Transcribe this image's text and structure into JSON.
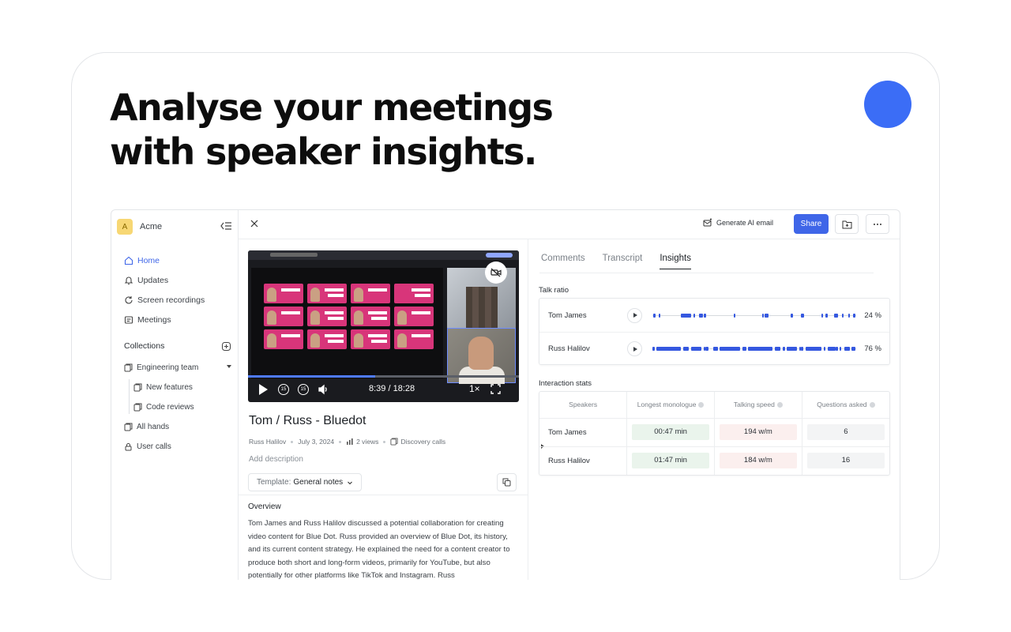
{
  "hero": {
    "line1": "Analyse your meetings",
    "line2": "with speaker insights."
  },
  "colors": {
    "accent": "#3b6df6",
    "primary_button": "#3f66e8",
    "bar": "#3558e0"
  },
  "workspace": {
    "initial": "A",
    "name": "Acme"
  },
  "sidebar": {
    "nav": [
      {
        "label": "Home",
        "icon": "home-icon",
        "active": true
      },
      {
        "label": "Updates",
        "icon": "bell-icon"
      },
      {
        "label": "Screen recordings",
        "icon": "refresh-icon"
      },
      {
        "label": "Meetings",
        "icon": "meetings-icon"
      }
    ],
    "collections_title": "Collections",
    "collections": [
      {
        "label": "Engineering team",
        "icon": "folder-icon",
        "expanded": true
      },
      {
        "label": "New features",
        "icon": "folder-icon",
        "sub": true
      },
      {
        "label": "Code reviews",
        "icon": "folder-icon",
        "sub": true
      },
      {
        "label": "All hands",
        "icon": "folder-icon"
      },
      {
        "label": "User calls",
        "icon": "lock-icon",
        "collapsed": true
      }
    ]
  },
  "topbar": {
    "generate_email": "Generate AI email",
    "share": "Share"
  },
  "video": {
    "current_time": "8:39 / 18:28",
    "speed": "1×",
    "skip_back": "15",
    "skip_forward": "15",
    "progress_fraction": 0.47
  },
  "recording": {
    "title": "Tom / Russ - Bluedot",
    "owner": "Russ Halilov",
    "date": "July 3, 2024",
    "views": "2 views",
    "collection": "Discovery calls",
    "add_description": "Add description",
    "template_label": "Template:",
    "template_value": "General notes"
  },
  "overview": {
    "heading": "Overview",
    "text": "Tom James and Russ Halilov discussed a potential collaboration for creating video content for Blue Dot. Russ provided an overview of Blue Dot, its history, and its current content strategy. He explained the need for a content creator to produce both short and long-form videos, primarily for YouTube, but also potentially for other platforms like TikTok and Instagram. Russ"
  },
  "tabs": [
    {
      "label": "Comments"
    },
    {
      "label": "Transcript"
    },
    {
      "label": "Insights",
      "active": true
    }
  ],
  "talk_ratio": {
    "title": "Talk ratio",
    "speakers": [
      {
        "name": "Tom James",
        "percent": "24 %",
        "segments": [
          [
            0.005,
            0.01
          ],
          [
            0.03,
            0.01
          ],
          [
            0.14,
            0.05
          ],
          [
            0.2,
            0.01
          ],
          [
            0.23,
            0.02
          ],
          [
            0.25,
            0.015
          ],
          [
            0.4,
            0.006
          ],
          [
            0.55,
            0.02
          ],
          [
            0.54,
            0.006
          ],
          [
            0.68,
            0.01
          ],
          [
            0.73,
            0.016
          ],
          [
            0.83,
            0.006
          ],
          [
            0.85,
            0.01
          ],
          [
            0.89,
            0.02
          ],
          [
            0.93,
            0.006
          ],
          [
            0.96,
            0.01
          ],
          [
            0.985,
            0.012
          ]
        ]
      },
      {
        "name": "Russ Halilov",
        "percent": "76 %",
        "segments": [
          [
            0.0,
            0.012
          ],
          [
            0.02,
            0.12
          ],
          [
            0.15,
            0.03
          ],
          [
            0.19,
            0.05
          ],
          [
            0.25,
            0.006
          ],
          [
            0.26,
            0.016
          ],
          [
            0.3,
            0.02
          ],
          [
            0.33,
            0.1
          ],
          [
            0.44,
            0.02
          ],
          [
            0.47,
            0.12
          ],
          [
            0.6,
            0.026
          ],
          [
            0.64,
            0.01
          ],
          [
            0.66,
            0.05
          ],
          [
            0.72,
            0.006
          ],
          [
            0.73,
            0.01
          ],
          [
            0.75,
            0.08
          ],
          [
            0.84,
            0.01
          ],
          [
            0.86,
            0.04
          ],
          [
            0.9,
            0.012
          ],
          [
            0.92,
            0.006
          ],
          [
            0.94,
            0.03
          ],
          [
            0.975,
            0.02
          ]
        ]
      }
    ]
  },
  "interaction": {
    "title": "Interaction stats",
    "headers": [
      "Speakers",
      "Longest monologue",
      "Talking speed",
      "Questions asked"
    ],
    "rows": [
      {
        "name": "Tom James",
        "monologue": "00:47 min",
        "speed": "194 w/m",
        "questions": "6"
      },
      {
        "name": "Russ Halilov",
        "monologue": "01:47 min",
        "speed": "184 w/m",
        "questions": "16"
      }
    ]
  }
}
